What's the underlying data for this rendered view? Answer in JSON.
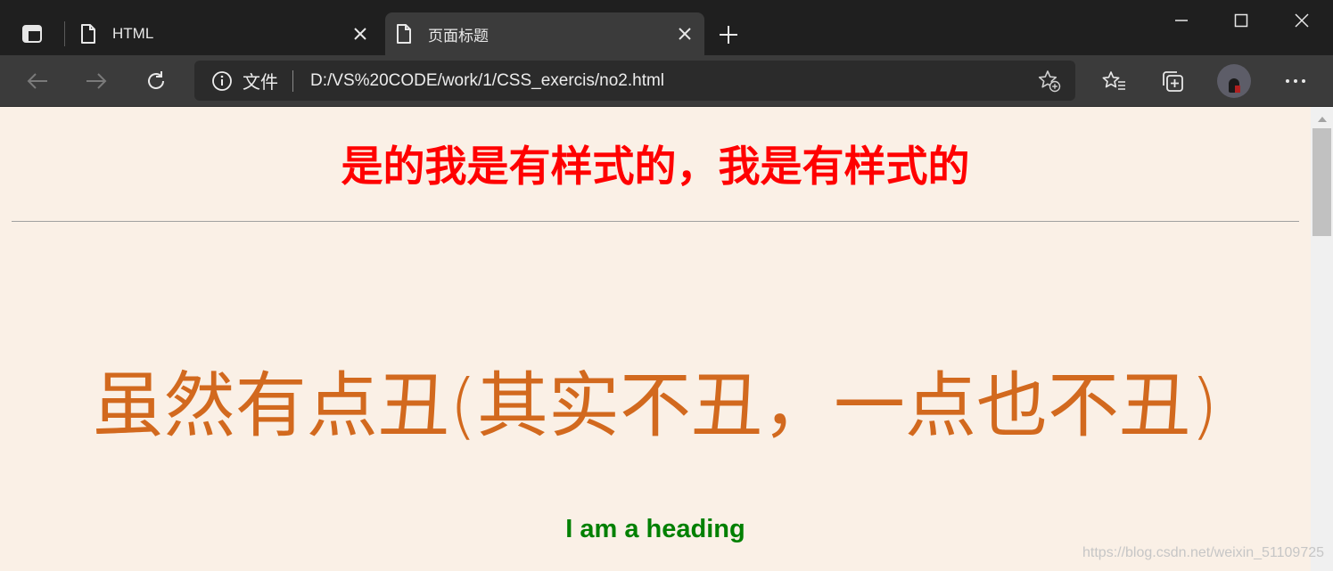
{
  "browser": {
    "tabs": [
      {
        "title": "HTML",
        "active": false
      },
      {
        "title": "页面标题",
        "active": true
      }
    ],
    "address_bar": {
      "security_label": "文件",
      "url": "D:/VS%20CODE/work/1/CSS_exercis/no2.html"
    }
  },
  "page": {
    "red_heading": "是的我是有样式的，我是有样式的",
    "orange_text": "虽然有点丑(其实不丑，一点也不丑)",
    "green_heading": "I am a heading",
    "background_color": "#faf0e6",
    "colors": {
      "red_heading": "#ff0000",
      "orange_text": "#d2691e",
      "green_heading": "#008000"
    }
  },
  "watermark": "https://blog.csdn.net/weixin_51109725"
}
